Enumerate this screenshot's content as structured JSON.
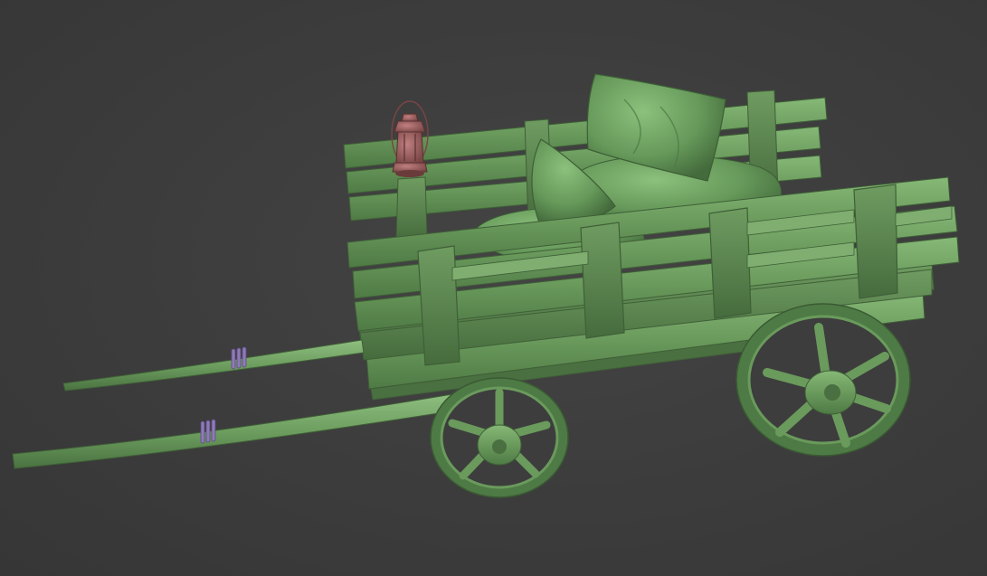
{
  "scene": {
    "background_color": "#3d3d3d",
    "model_color": "#6a9a5c",
    "model_shadow_color": "#4a6f40",
    "model_highlight_color": "#86b877",
    "lantern_color": "#9a5a5a",
    "binding_color": "#8f7ab8",
    "objects": [
      "wooden-cart",
      "cart-shafts",
      "cart-wheels",
      "cushions",
      "lantern",
      "shaft-bindings"
    ]
  }
}
